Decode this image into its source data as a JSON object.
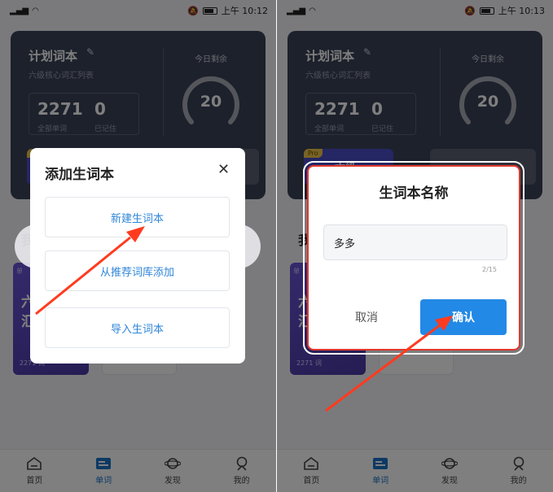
{
  "status": {
    "signal": "℃℃",
    "time_left": "上午 10:12",
    "time_right": "上午 10:13"
  },
  "plan": {
    "title": "计划词本",
    "subtitle": "六级核心词汇列表",
    "total_words": "2271",
    "total_label": "全部单词",
    "remembered": "0",
    "remembered_label": "已记住",
    "today_label": "今日剩余",
    "today_remaining": "20",
    "pro_badge": "Pro",
    "pro_text": "六级"
  },
  "my_section": {
    "title": "我",
    "book_badge": "单",
    "book_title_1": "六",
    "book_title_2": "汇",
    "book_count": "2271 词"
  },
  "tabbar": [
    {
      "label": "首页",
      "icon": "home-icon"
    },
    {
      "label": "单词",
      "icon": "word-card-icon",
      "active": true
    },
    {
      "label": "发现",
      "icon": "planet-icon"
    },
    {
      "label": "我的",
      "icon": "profile-icon"
    }
  ],
  "add_dialog": {
    "title": "添加生词本",
    "options": [
      "新建生词本",
      "从推荐词库添加",
      "导入生词本"
    ]
  },
  "name_dialog": {
    "title": "生词本名称",
    "input_value": "多多",
    "counter": "2/15",
    "cancel": "取消",
    "confirm": "确认"
  },
  "colors": {
    "accent": "#2389e6",
    "card_bg": "#3a4358",
    "highlight": "#e2372c"
  }
}
